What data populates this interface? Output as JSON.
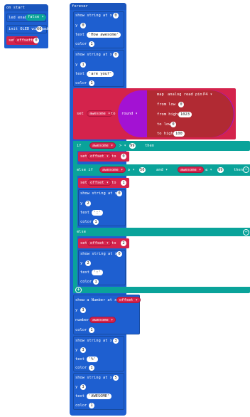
{
  "on_start": {
    "hat": "on start",
    "led_enable": "led enable",
    "led_value": "false ▾",
    "init_oled": "init OLED with addr",
    "oled_addr": "60",
    "set": "set",
    "var_offset": "offset ▾",
    "to": "to",
    "offset_value": "0"
  },
  "forever": {
    "hat": "forever",
    "show_string_at_x": "show string at x",
    "y": "y",
    "text": "text",
    "color": "color",
    "blk1": {
      "x": "0",
      "y": "0",
      "text": "'How awesome'",
      "color": "1"
    },
    "blk2": {
      "x": "0",
      "y": "1",
      "text": "'are you?'",
      "color": "1"
    },
    "set_awesome": {
      "set": "set",
      "var": "awesome ▾",
      "to": "to",
      "round": "round ▾",
      "map": "map",
      "analog_read_pin": "analog read pin",
      "pin": "P4 ▾",
      "from_low": "from low",
      "from_low_v": "0",
      "from_high": "from high",
      "from_high_v": "1023",
      "to_low": "to low",
      "to_low_v": "0",
      "to_high": "to high",
      "to_high_v": "100"
    },
    "if_block": {
      "if": "if",
      "var": "awesome ▾",
      "op": "> ▾",
      "value": "99",
      "then": "then",
      "set": "set",
      "offset": "offset ▾",
      "to": "to",
      "set_value": "0"
    },
    "else_if": {
      "label": "else if",
      "var1": "awesome ▾",
      "op1": "≥ ▾",
      "v1": "50",
      "and": "and ▾",
      "var2": "awesome ▾",
      "op2": "≤ ▾",
      "v2": "99",
      "then": "then",
      "set": "set",
      "offset": "offset ▾",
      "to": "to",
      "set_value": "1",
      "x": "0",
      "y": "2",
      "text": "':'",
      "color": "1"
    },
    "else_block": {
      "label": "else",
      "set": "set",
      "offset": "offset ▾",
      "to": "to",
      "set_value": "2",
      "x": "0",
      "y": "2",
      "text": "':'",
      "color": "1"
    },
    "show_number": {
      "label": "show a Number at x",
      "offset": "offset ▾",
      "y": "y",
      "y_v": "3",
      "number": "number",
      "awesome": "awesome ▾",
      "color": "color",
      "color_v": "1"
    },
    "blk3": {
      "x": "3",
      "y": "3",
      "text": "'%'",
      "color": "1"
    },
    "blk4": {
      "x": "5",
      "y": "3",
      "text": "'AWESOME'",
      "color": "1"
    }
  },
  "colors": {
    "blue": "#1e5fd0",
    "teal": "#0aa39a",
    "red": "#d4234c",
    "purple": "#a312d3",
    "maroon": "#b12a33"
  }
}
